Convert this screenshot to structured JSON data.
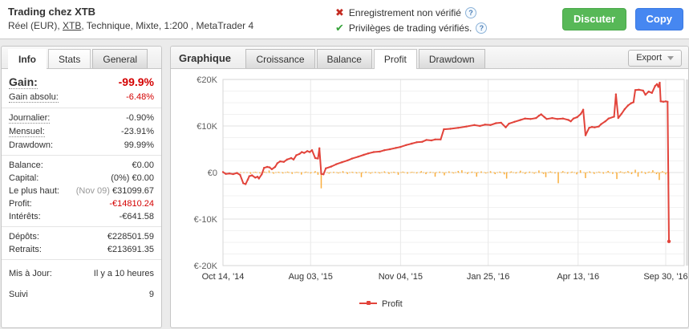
{
  "theme": {
    "negative_text": "#d40000",
    "profit_line": "#e2443b",
    "daily_bars": "#f9ae3d",
    "discuss_green": "#57b857",
    "copy_blue": "#4687f1"
  },
  "header": {
    "title": "Trading chez XTB",
    "subtitle_prefix": "Réel (EUR), ",
    "subtitle_link": "XTB",
    "subtitle_suffix": ", Technique, Mixte, 1:200 , MetaTrader 4",
    "verifications": [
      {
        "icon": "cross-icon",
        "text": "Enregistrement non vérifié",
        "help": "?"
      },
      {
        "icon": "check-icon",
        "text": "Privilèges de trading vérifiés.",
        "help": "?"
      }
    ],
    "discuss_label": "Discuter",
    "copy_label": "Copy"
  },
  "sidebar": {
    "tabs": [
      {
        "label": "Info",
        "active": true
      },
      {
        "label": "Stats",
        "variant": "light"
      },
      {
        "label": "General",
        "variant": "gray"
      }
    ],
    "groups": [
      {
        "rows": [
          {
            "label": "Gain:",
            "value": "-99.9%",
            "big": true,
            "negative": true,
            "dotted": true
          },
          {
            "label": "Gain absolu:",
            "value": "-6.48%",
            "negative": true,
            "dotted": true
          }
        ]
      },
      {
        "rows": [
          {
            "label": "Journalier:",
            "value": "-0.90%",
            "dotted": true
          },
          {
            "label": "Mensuel:",
            "value": "-23.91%",
            "dotted": true
          },
          {
            "label": "Drawdown:",
            "value": "99.99%"
          }
        ]
      },
      {
        "rows": [
          {
            "label": "Balance:",
            "value": "€0.00"
          },
          {
            "label": "Capital:",
            "value": "(0%) €0.00"
          },
          {
            "label": "Le plus haut:",
            "value": "€31099.67",
            "value_prefix": "(Nov 09) "
          },
          {
            "label": "Profit:",
            "value": "-€14810.24",
            "negative": true
          },
          {
            "label": "Intérêts:",
            "value": "-€641.58"
          }
        ]
      },
      {
        "rows": [
          {
            "label": "Dépôts:",
            "value": "€228501.59"
          },
          {
            "label": "Retraits:",
            "value": "€213691.35"
          }
        ]
      },
      {
        "rows": [
          {
            "label": "Mis à Jour:",
            "value": "Il y a 10 heures",
            "spaced": true
          },
          {
            "label": "Suivi",
            "value": "9",
            "spaced": true
          }
        ]
      }
    ]
  },
  "chart_panel": {
    "title": "Graphique",
    "tabs": [
      {
        "label": "Croissance"
      },
      {
        "label": "Balance"
      },
      {
        "label": "Profit",
        "active": true
      },
      {
        "label": "Drawdown"
      }
    ],
    "export_label": "Export"
  },
  "chart_data": {
    "type": "line",
    "unit": "EUR, values in thousands (K)",
    "ylim": [
      -20,
      20
    ],
    "grid": true,
    "legend_position": "bottom",
    "y_ticks": [
      {
        "label": "€20K",
        "value": 20
      },
      {
        "label": "€10K",
        "value": 10
      },
      {
        "label": "€0",
        "value": 0
      },
      {
        "label": "€-10K",
        "value": -10
      },
      {
        "label": "€-20K",
        "value": -20
      }
    ],
    "x_ticks": [
      {
        "label": "Oct 14, '14",
        "f": 0.0
      },
      {
        "label": "Aug 03, '15",
        "f": 0.19
      },
      {
        "label": "Nov 04, '15",
        "f": 0.385
      },
      {
        "label": "Jan 25, '16",
        "f": 0.575
      },
      {
        "label": "Apr 13, '16",
        "f": 0.77
      },
      {
        "label": "Sep 30, '16",
        "f": 0.96
      }
    ],
    "series": [
      {
        "name": "Profit",
        "color": "#e2443b",
        "points": [
          [
            0.0,
            0.1
          ],
          [
            0.006,
            -0.3
          ],
          [
            0.014,
            -0.2
          ],
          [
            0.022,
            -0.35
          ],
          [
            0.03,
            -0.1
          ],
          [
            0.037,
            -0.5
          ],
          [
            0.044,
            -2.3
          ],
          [
            0.049,
            -2.5
          ],
          [
            0.054,
            -1.5
          ],
          [
            0.057,
            -0.8
          ],
          [
            0.063,
            -0.6
          ],
          [
            0.07,
            -1.1
          ],
          [
            0.075,
            -0.9
          ],
          [
            0.078,
            -1.3
          ],
          [
            0.084,
            -0.4
          ],
          [
            0.089,
            1.0
          ],
          [
            0.096,
            1.2
          ],
          [
            0.101,
            1.1
          ],
          [
            0.106,
            0.7
          ],
          [
            0.113,
            1.2
          ],
          [
            0.118,
            2.0
          ],
          [
            0.124,
            2.4
          ],
          [
            0.132,
            2.3
          ],
          [
            0.139,
            2.8
          ],
          [
            0.148,
            3.1
          ],
          [
            0.153,
            2.8
          ],
          [
            0.159,
            3.7
          ],
          [
            0.166,
            4.0
          ],
          [
            0.171,
            4.4
          ],
          [
            0.176,
            4.2
          ],
          [
            0.183,
            4.6
          ],
          [
            0.188,
            4.4
          ],
          [
            0.193,
            4.8
          ],
          [
            0.2,
            3.1
          ],
          [
            0.206,
            3.0
          ],
          [
            0.209,
            5.2
          ],
          [
            0.213,
            -0.3
          ],
          [
            0.218,
            -0.4
          ],
          [
            0.223,
            0.9
          ],
          [
            0.235,
            1.3
          ],
          [
            0.246,
            1.8
          ],
          [
            0.258,
            2.2
          ],
          [
            0.27,
            2.6
          ],
          [
            0.28,
            3.0
          ],
          [
            0.293,
            3.4
          ],
          [
            0.305,
            3.8
          ],
          [
            0.315,
            4.1
          ],
          [
            0.327,
            4.4
          ],
          [
            0.34,
            4.5
          ],
          [
            0.35,
            4.8
          ],
          [
            0.362,
            5.0
          ],
          [
            0.375,
            5.3
          ],
          [
            0.385,
            5.5
          ],
          [
            0.397,
            5.9
          ],
          [
            0.409,
            6.2
          ],
          [
            0.42,
            6.5
          ],
          [
            0.432,
            6.6
          ],
          [
            0.441,
            7.0
          ],
          [
            0.452,
            6.9
          ],
          [
            0.46,
            7.1
          ],
          [
            0.472,
            7.1
          ],
          [
            0.479,
            9.3
          ],
          [
            0.493,
            9.4
          ],
          [
            0.51,
            9.6
          ],
          [
            0.528,
            9.9
          ],
          [
            0.545,
            10.2
          ],
          [
            0.557,
            10.0
          ],
          [
            0.568,
            10.3
          ],
          [
            0.58,
            10.2
          ],
          [
            0.592,
            10.6
          ],
          [
            0.603,
            10.7
          ],
          [
            0.613,
            9.7
          ],
          [
            0.62,
            10.5
          ],
          [
            0.632,
            10.9
          ],
          [
            0.645,
            11.3
          ],
          [
            0.655,
            11.6
          ],
          [
            0.667,
            11.5
          ],
          [
            0.679,
            11.7
          ],
          [
            0.685,
            12.2
          ],
          [
            0.69,
            12.5
          ],
          [
            0.697,
            11.9
          ],
          [
            0.702,
            11.5
          ],
          [
            0.714,
            11.7
          ],
          [
            0.725,
            11.5
          ],
          [
            0.737,
            11.6
          ],
          [
            0.749,
            11.3
          ],
          [
            0.754,
            11.0
          ],
          [
            0.76,
            11.6
          ],
          [
            0.768,
            11.9
          ],
          [
            0.776,
            12.6
          ],
          [
            0.781,
            13.5
          ],
          [
            0.786,
            8.0
          ],
          [
            0.794,
            9.6
          ],
          [
            0.8,
            9.8
          ],
          [
            0.806,
            9.7
          ],
          [
            0.815,
            9.9
          ],
          [
            0.82,
            10.4
          ],
          [
            0.829,
            11.0
          ],
          [
            0.836,
            11.6
          ],
          [
            0.848,
            12.0
          ],
          [
            0.852,
            16.8
          ],
          [
            0.857,
            11.7
          ],
          [
            0.864,
            12.6
          ],
          [
            0.871,
            13.6
          ],
          [
            0.878,
            14.4
          ],
          [
            0.885,
            14.9
          ],
          [
            0.89,
            15.1
          ],
          [
            0.894,
            17.7
          ],
          [
            0.902,
            17.8
          ],
          [
            0.911,
            17.6
          ],
          [
            0.916,
            16.7
          ],
          [
            0.923,
            17.4
          ],
          [
            0.93,
            17.1
          ],
          [
            0.937,
            18.6
          ],
          [
            0.941,
            19.0
          ],
          [
            0.944,
            18.4
          ],
          [
            0.947,
            19.3
          ],
          [
            0.949,
            15.3
          ],
          [
            0.955,
            15.2
          ],
          [
            0.96,
            15.3
          ],
          [
            0.964,
            15.2
          ],
          [
            0.967,
            -14.8
          ]
        ]
      }
    ],
    "bars": {
      "name": "daily-change",
      "color": "#f9ae3d",
      "points": [
        [
          0.06,
          -0.3
        ],
        [
          0.07,
          0.15
        ],
        [
          0.08,
          -0.2
        ],
        [
          0.09,
          0.2
        ],
        [
          0.1,
          0.45
        ],
        [
          0.11,
          -0.25
        ],
        [
          0.12,
          0.15
        ],
        [
          0.13,
          -0.2
        ],
        [
          0.14,
          0.2
        ],
        [
          0.15,
          -0.3
        ],
        [
          0.16,
          0.15
        ],
        [
          0.17,
          -0.45
        ],
        [
          0.18,
          0.2
        ],
        [
          0.19,
          -0.2
        ],
        [
          0.2,
          0.3
        ],
        [
          0.206,
          -0.5
        ],
        [
          0.213,
          -3.4
        ],
        [
          0.22,
          0.2
        ],
        [
          0.23,
          -0.25
        ],
        [
          0.24,
          0.15
        ],
        [
          0.25,
          -0.2
        ],
        [
          0.26,
          0.3
        ],
        [
          0.27,
          -0.3
        ],
        [
          0.28,
          0.15
        ],
        [
          0.29,
          -0.2
        ],
        [
          0.3,
          -1.0
        ],
        [
          0.31,
          0.2
        ],
        [
          0.32,
          -0.25
        ],
        [
          0.33,
          0.15
        ],
        [
          0.34,
          -0.2
        ],
        [
          0.35,
          0.25
        ],
        [
          0.36,
          -0.3
        ],
        [
          0.37,
          0.15
        ],
        [
          0.38,
          -0.5
        ],
        [
          0.39,
          0.2
        ],
        [
          0.4,
          -0.25
        ],
        [
          0.41,
          0.15
        ],
        [
          0.42,
          -0.2
        ],
        [
          0.43,
          0.3
        ],
        [
          0.44,
          -0.35
        ],
        [
          0.45,
          0.15
        ],
        [
          0.46,
          -0.9
        ],
        [
          0.47,
          0.2
        ],
        [
          0.48,
          -0.6
        ],
        [
          0.49,
          0.25
        ],
        [
          0.5,
          -0.2
        ],
        [
          0.51,
          0.35
        ],
        [
          0.518,
          0.5
        ],
        [
          0.53,
          -0.3
        ],
        [
          0.54,
          0.2
        ],
        [
          0.55,
          -0.9
        ],
        [
          0.56,
          0.25
        ],
        [
          0.57,
          -0.2
        ],
        [
          0.58,
          0.3
        ],
        [
          0.59,
          -0.35
        ],
        [
          0.6,
          0.2
        ],
        [
          0.61,
          -0.4
        ],
        [
          0.615,
          -1.3
        ],
        [
          0.625,
          0.25
        ],
        [
          0.635,
          -0.2
        ],
        [
          0.645,
          0.4
        ],
        [
          0.655,
          -0.3
        ],
        [
          0.665,
          0.2
        ],
        [
          0.675,
          -0.25
        ],
        [
          0.685,
          0.45
        ],
        [
          0.695,
          -0.3
        ],
        [
          0.7,
          -1.0
        ],
        [
          0.71,
          0.25
        ],
        [
          0.72,
          -0.2
        ],
        [
          0.727,
          -2.3
        ],
        [
          0.737,
          0.3
        ],
        [
          0.747,
          -0.25
        ],
        [
          0.757,
          0.2
        ],
        [
          0.767,
          -0.4
        ],
        [
          0.775,
          0.5
        ],
        [
          0.786,
          -1.2
        ],
        [
          0.795,
          0.25
        ],
        [
          0.805,
          -0.3
        ],
        [
          0.815,
          0.2
        ],
        [
          0.825,
          -0.25
        ],
        [
          0.835,
          0.35
        ],
        [
          0.845,
          -0.3
        ],
        [
          0.854,
          -1.4
        ],
        [
          0.862,
          0.25
        ],
        [
          0.87,
          -0.2
        ],
        [
          0.878,
          0.3
        ],
        [
          0.886,
          -0.35
        ],
        [
          0.894,
          0.6
        ],
        [
          0.9,
          -0.9
        ],
        [
          0.908,
          0.25
        ],
        [
          0.916,
          -0.3
        ],
        [
          0.924,
          0.2
        ],
        [
          0.932,
          0.5
        ],
        [
          0.94,
          -0.35
        ],
        [
          0.946,
          -1.6
        ],
        [
          0.953,
          0.3
        ],
        [
          0.96,
          -0.4
        ],
        [
          0.966,
          -2.5
        ]
      ]
    }
  }
}
